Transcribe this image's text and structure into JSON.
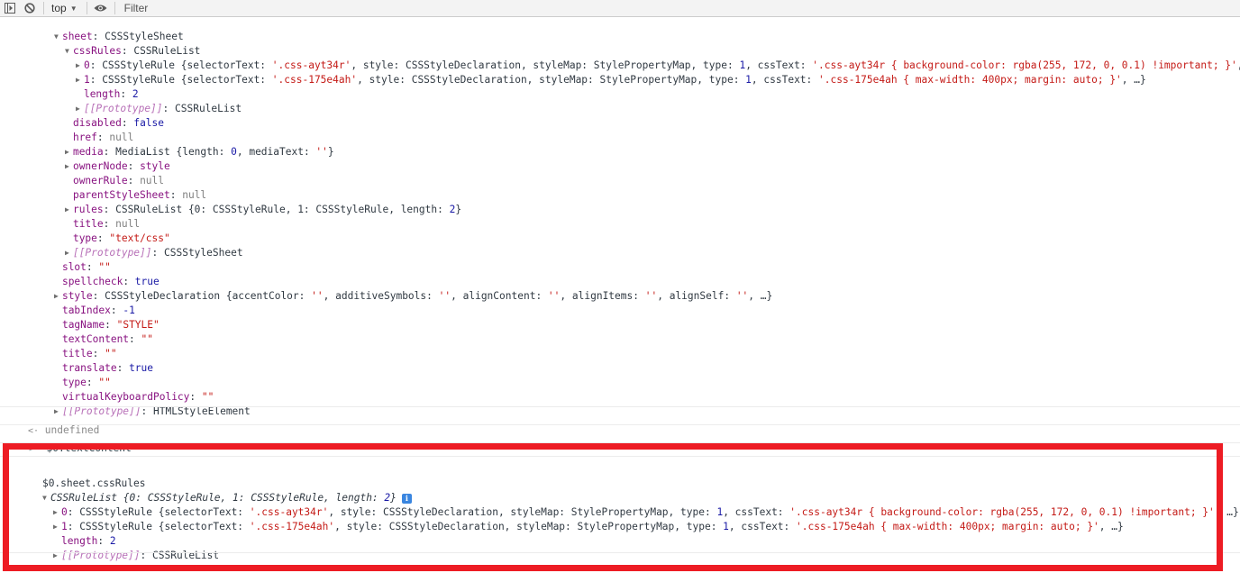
{
  "toolbar": {
    "sidebar_toggle_icon": "sidebar-toggle-icon",
    "clear_icon": "clear-console-icon",
    "context": "top",
    "eye_icon": "live-expression-icon",
    "filter_placeholder": "Filter"
  },
  "tree": {
    "sheet_key": "sheet",
    "sheet_val": "CSSStyleSheet",
    "cssRules_key": "cssRules",
    "cssRules_val": "CSSRuleList",
    "rules": [
      {
        "idx": "0",
        "selector": "'.css-ayt34r'",
        "cssText": "'.css-ayt34r { background-color: rgba(255, 172, 0, 0.1) !important; }'"
      },
      {
        "idx": "1",
        "selector": "'.css-175e4ah'",
        "cssText": "'.css-175e4ah { max-width: 400px; margin: auto; }'"
      }
    ],
    "rule_type_label": "CSSStyleRule",
    "length_key": "length",
    "length_val": "2",
    "proto_key": "[[Prototype]]",
    "rulelist_proto": "CSSRuleList",
    "disabled_key": "disabled",
    "disabled_val": "false",
    "href_key": "href",
    "href_val": "null",
    "media_key": "media",
    "media_val": "MediaList {length: ",
    "media_len": "0",
    "media_text": ", mediaText: ",
    "media_text_val": "''",
    "media_close": "}",
    "ownerNode_key": "ownerNode",
    "ownerNode_val": "style",
    "ownerRule_key": "ownerRule",
    "ownerRule_val": "null",
    "parentStyleSheet_key": "parentStyleSheet",
    "parentStyleSheet_val": "null",
    "rules_key": "rules",
    "rules_val": "CSSRuleList {0: CSSStyleRule, 1: CSSStyleRule, length: ",
    "rules_len": "2",
    "rules_close": "}",
    "title_key": "title",
    "title_val": "null",
    "type_key": "type",
    "type_val": "\"text/css\"",
    "sheet_proto": "CSSStyleSheet",
    "slot_key": "slot",
    "slot_val": "\"\"",
    "spellcheck_key": "spellcheck",
    "spellcheck_val": "true",
    "style_key": "style",
    "style_val": "CSSStyleDeclaration {accentColor: ",
    "style_props": [
      "accentColor",
      "additiveSymbols",
      "alignContent",
      "alignItems",
      "alignSelf"
    ],
    "tabIndex_key": "tabIndex",
    "tabIndex_val": "-1",
    "tagName_key": "tagName",
    "tagName_val": "\"STYLE\"",
    "textContent_key": "textContent",
    "textContent_val": "\"\"",
    "eltitle_key": "title",
    "eltitle_val": "\"\"",
    "translate_key": "translate",
    "translate_val": "true",
    "eltype_key": "type",
    "eltype_val": "\"\"",
    "vkp_key": "virtualKeyboardPolicy",
    "vkp_val": "\"\"",
    "element_proto": "HTMLStyleElement"
  },
  "log": {
    "result_undefined": "undefined",
    "input_1": "$0.textContent",
    "input_2": "$0.sheet.cssRules",
    "result_summary": "CSSRuleList {0: CSSStyleRule, 1: CSSStyleRule, length: ",
    "result_len": "2",
    "result_close": "}",
    "info_badge": "i"
  },
  "highlight": {
    "color": "#ed1c24"
  }
}
